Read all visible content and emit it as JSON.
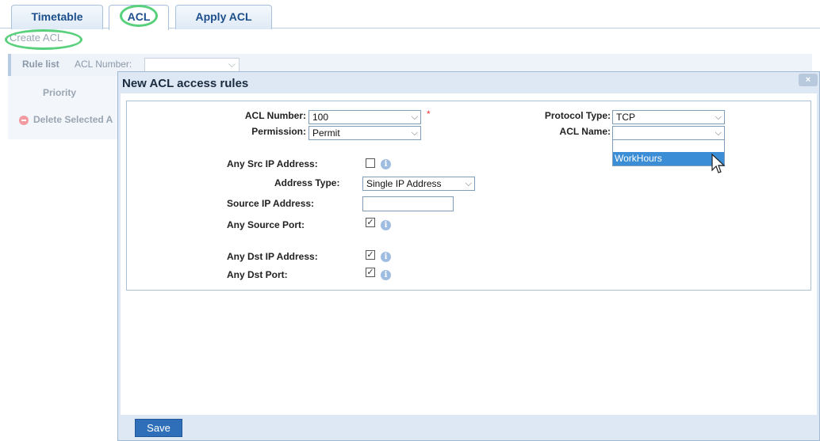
{
  "tabs": [
    {
      "label": "Timetable"
    },
    {
      "label": "ACL"
    },
    {
      "label": "Apply ACL"
    }
  ],
  "toolbar": {
    "create_acl": "Create ACL"
  },
  "rulebar": {
    "rule_list": "Rule list",
    "acl_number_label": "ACL Number:"
  },
  "table": {
    "priority_header": "Priority"
  },
  "actions": {
    "delete_selected": "Delete Selected A"
  },
  "dialog": {
    "title": "New ACL access rules",
    "close": "×",
    "save": "Save"
  },
  "form": {
    "acl_number": {
      "label": "ACL Number:",
      "value": "100",
      "required_mark": "*"
    },
    "permission": {
      "label": "Permission:",
      "value": "Permit"
    },
    "protocol_type": {
      "label": "Protocol Type:",
      "value": "TCP"
    },
    "acl_name": {
      "label": "ACL Name:",
      "value": "",
      "options": [
        "WorkHours"
      ],
      "highlighted": "WorkHours"
    },
    "any_src_ip": {
      "label": "Any Src IP Address:",
      "checked": false
    },
    "address_type": {
      "label": "Address Type:",
      "value": "Single IP Address"
    },
    "source_ip": {
      "label": "Source IP Address:",
      "value": ""
    },
    "any_source_port": {
      "label": "Any Source Port:",
      "checked": true
    },
    "any_dst_ip": {
      "label": "Any Dst IP Address:",
      "checked": true
    },
    "any_dst_port": {
      "label": "Any Dst Port:",
      "checked": true
    }
  },
  "glyphs": {
    "chevron": "⌵",
    "check": "✓",
    "info": "i"
  },
  "colors": {
    "tab_text": "#1c4f8c",
    "highlight_circle": "#58d07c",
    "selection": "#3b8ed6",
    "save_button": "#2f6fba"
  }
}
